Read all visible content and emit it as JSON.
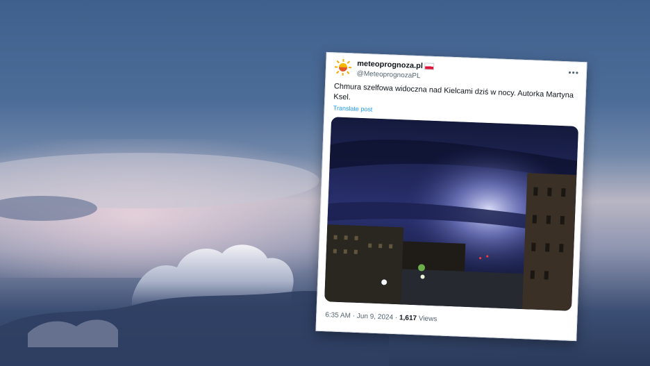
{
  "tweet": {
    "display_name": "meteoprognoza.pl",
    "handle": "@MeteoprognozaPL",
    "more_icon": "more-dots-icon",
    "text": "Chmura szelfowa widoczna nad Kielcami dziś w nocy. Autorka Martyna Ksel.",
    "translate_label": "Translate post",
    "time": "6:35 AM",
    "separator": "·",
    "date": "Jun 9, 2024",
    "views_count": "1,617",
    "views_label": "Views"
  },
  "colors": {
    "sky_top": "#3f5f8c",
    "link": "#1d9bf0",
    "muted_text": "#536471"
  }
}
